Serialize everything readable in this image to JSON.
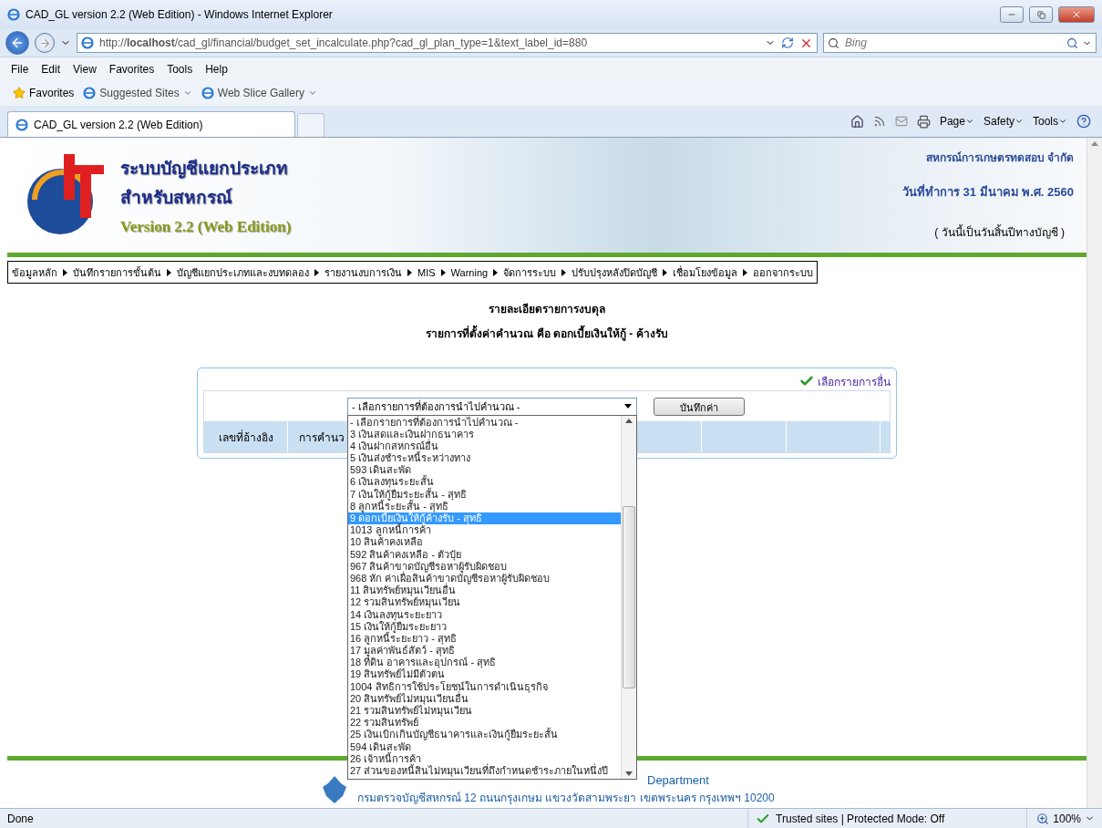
{
  "browser": {
    "title": "CAD_GL version 2.2 (Web Edition) - Windows Internet Explorer",
    "address": "http://**localhost**/cad_gl/financial/budget_set_incalculate.php?cad_gl_plan_type=1&text_label_id=880",
    "search_placeholder": "Bing",
    "menu": [
      "File",
      "Edit",
      "View",
      "Favorites",
      "Tools",
      "Help"
    ],
    "favorites": [
      "Favorites",
      "Suggested Sites",
      "Web Slice Gallery"
    ],
    "tab": "CAD_GL version 2.2 (Web Edition)",
    "commands": [
      "Page",
      "Safety",
      "Tools"
    ],
    "status": {
      "text": "Done",
      "zone": "Trusted sites | Protected Mode: Off",
      "zoom": "100%"
    }
  },
  "header": {
    "title_lines": [
      "ระบบบัญชีแยกประเภท",
      "สำหรับสหกรณ์"
    ],
    "version": "Version 2.2 (Web Edition)",
    "org": "สหกรณ์การเกษตรทดสอบ จำกัด",
    "date": "วันที่ทำการ 31 มีนาคม พ.ศ. 2560",
    "note": "( วันนี้เป็นวันสิ้นปีทางบัญชี )"
  },
  "nav": [
    "ข้อมูลหลัก",
    "บันทึกรายการขั้นต้น",
    "บัญชีแยกประเภทและงบทดลอง",
    "รายงานงบการเงิน",
    "MIS",
    "Warning",
    "จัดการระบบ",
    "ปรับปรุงหลังปิดบัญชี",
    "เชื่อมโยงข้อมูล",
    "ออกจากระบบ"
  ],
  "heading": "รายละเอียดรายการงบดุล",
  "subheading": "รายการที่ตั้งค่าคำนวณ คือ ดอกเบี้ยเงินให้กู้ - ค้างรับ",
  "panel": {
    "other_link": "เลือกรายการอื่น",
    "select_value": "- เลือกรายการที่ต้องการนำไปคำนวณ -",
    "save_button": "บันทึกค่า",
    "columns": [
      "เลขที่อ้างอิง",
      "การคำนว"
    ],
    "options": [
      {
        "label": "- เลือกรายการที่ต้องการนำไปคำนวณ -",
        "selected": false
      },
      {
        "label": "3 เงินสดและเงินฝากธนาคาร",
        "selected": false
      },
      {
        "label": "4 เงินฝากสหกรณ์อื่น",
        "selected": false
      },
      {
        "label": "5 เงินส่งชำระหนี้ระหว่างทาง",
        "selected": false
      },
      {
        "label": "593 เดินสะพัด",
        "selected": false
      },
      {
        "label": "6 เงินลงทุนระยะสั้น",
        "selected": false
      },
      {
        "label": "7 เงินให้กู้ยืมระยะสั้น - สุทธิ",
        "selected": false
      },
      {
        "label": "8 ลูกหนี้ระยะสั้น - สุทธิ",
        "selected": false
      },
      {
        "label": "9 ดอกเบี้ยเงินให้กู้ค้างรับ - สุทธิ",
        "selected": true
      },
      {
        "label": "1013 ลูกหนี้การค้า",
        "selected": false
      },
      {
        "label": "10 สินค้าคงเหลือ",
        "selected": false
      },
      {
        "label": "592 สินค้าคงเหลือ - ตัวปุ๋ย",
        "selected": false
      },
      {
        "label": "967 สินค้าขาดบัญชีรอหาผู้รับผิดชอบ",
        "selected": false
      },
      {
        "label": "968 หัก ค่าเผื่อสินค้าขาดบัญชีรอหาผู้รับผิดชอบ",
        "selected": false
      },
      {
        "label": "11 สินทรัพย์หมุนเวียนอื่น",
        "selected": false
      },
      {
        "label": "12 รวมสินทรัพย์หมุนเวียน",
        "selected": false
      },
      {
        "label": "14 เงินลงทุนระยะยาว",
        "selected": false
      },
      {
        "label": "15 เงินให้กู้ยืมระยะยาว",
        "selected": false
      },
      {
        "label": "16 ลูกหนี้ระยะยาว - สุทธิ",
        "selected": false
      },
      {
        "label": "17 มูลค่าพันธ์สัตว์ - สุทธิ",
        "selected": false
      },
      {
        "label": "18 ที่ดิน อาคารและอุปกรณ์ - สุทธิ",
        "selected": false
      },
      {
        "label": "19 สินทรัพย์ไม่มีตัวตน",
        "selected": false
      },
      {
        "label": "1004 สิทธิการใช้ประโยชน์ในการดำเนินธุรกิจ",
        "selected": false
      },
      {
        "label": "20 สินทรัพย์ไม่หมุนเวียนอื่น",
        "selected": false
      },
      {
        "label": "21 รวมสินทรัพย์ไม่หมุนเวียน",
        "selected": false
      },
      {
        "label": "22 รวมสินทรัพย์",
        "selected": false
      },
      {
        "label": "25 เงินเบิกเกินบัญชีธนาคารและเงินกู้ยืมระยะสั้น",
        "selected": false
      },
      {
        "label": "594 เดินสะพัด",
        "selected": false
      },
      {
        "label": "26 เจ้าหนี้การค้า",
        "selected": false
      },
      {
        "label": "27 ส่วนของหนี้สินไม่หมุนเวียนที่ถึงกำหนดชำระภายในหนึ่งปี",
        "selected": false
      }
    ]
  },
  "footer": {
    "line1": "Department",
    "line2": "กรมตรวจบัญชีสหกรณ์ 12 ถนนกรุงเกษม แขวงวัดสามพระยา เขตพระนคร กรุงเทพฯ 10200"
  }
}
